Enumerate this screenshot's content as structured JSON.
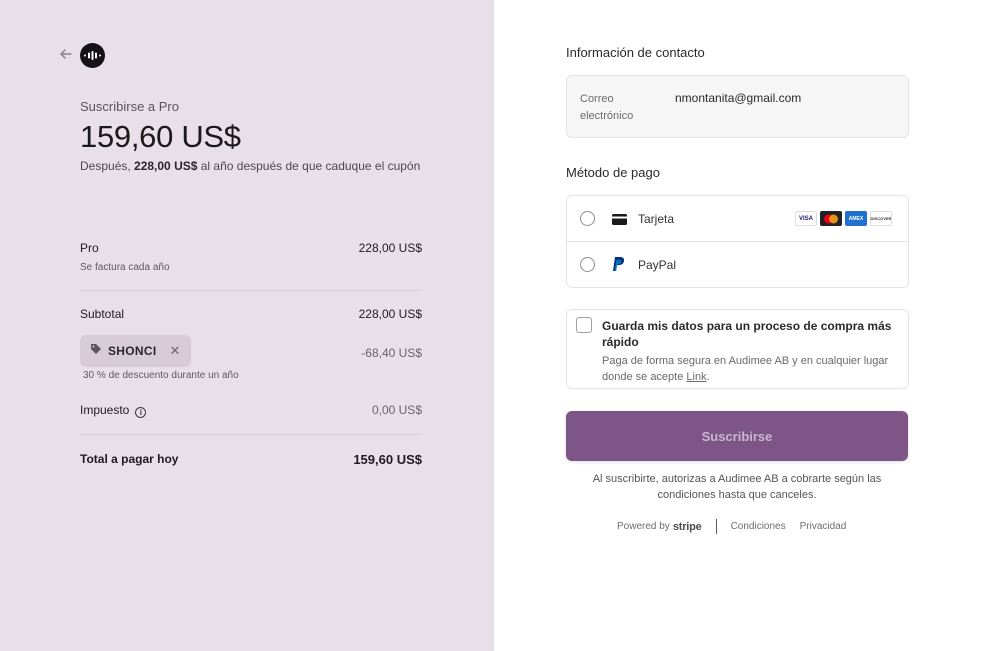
{
  "summary": {
    "back_icon": "arrow-left-icon",
    "logo_icon": "audio-wave-icon",
    "subscribe_label": "Suscribirse a Pro",
    "price": "159,60 US$",
    "after_prefix": "Después, ",
    "after_amount": "228,00 US$",
    "after_suffix": " al año después de que caduque el cupón",
    "items": [
      {
        "name": "Pro",
        "note": "Se factura cada año",
        "amount": "228,00 US$"
      }
    ],
    "subtotal_label": "Subtotal",
    "subtotal_amount": "228,00 US$",
    "coupon": {
      "code": "SHONCI",
      "discount": "-68,40 US$",
      "note": "30 % de descuento durante un año"
    },
    "tax_label": "Impuesto",
    "tax_amount": "0,00 US$",
    "total_label": "Total a pagar hoy",
    "total_amount": "159,60 US$"
  },
  "contact": {
    "heading": "Información de contacto",
    "email_label": "Correo electrónico",
    "email_value": "nmontanita@gmail.com"
  },
  "payment": {
    "heading": "Método de pago",
    "options": [
      {
        "label": "Tarjeta",
        "icon": "credit-card-icon"
      },
      {
        "label": "PayPal",
        "icon": "paypal-icon"
      }
    ],
    "card_brands": [
      "VISA",
      "Mastercard",
      "AMEX",
      "DISCOVER"
    ]
  },
  "save": {
    "title": "Guarda mis datos para un proceso de compra más rápido",
    "desc_prefix": "Paga de forma segura en Audimee AB y en cualquier lugar donde se acepte ",
    "desc_link": "Link",
    "desc_suffix": "."
  },
  "cta": {
    "label": "Suscribirse"
  },
  "terms": "Al suscribirte, autorizas a Audimee AB a cobrarte según las condiciones hasta que canceles.",
  "footer": {
    "powered_by": "Powered by",
    "brand": "stripe",
    "links": [
      "Condiciones",
      "Privacidad"
    ]
  },
  "colors": {
    "left_bg": "#e9dfe9",
    "button_bg": "#7e5587",
    "button_text": "#c9b5cf"
  }
}
